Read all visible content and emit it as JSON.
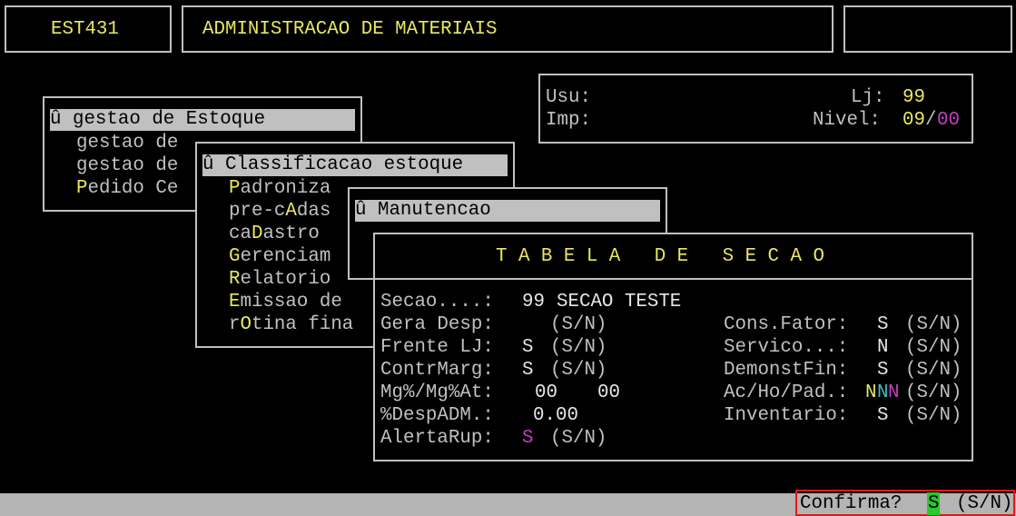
{
  "header": {
    "program_code": "EST431",
    "system_title": "ADMINISTRACAO DE MATERIAIS",
    "right_box": ""
  },
  "user_panel": {
    "usu_label": "Usu:",
    "imp_label": "Imp:",
    "lj_label": "Lj:",
    "lj_value": "99",
    "nivel_label": "Nivel:",
    "nivel_value_a": "09",
    "nivel_sep": "/",
    "nivel_value_b": "00"
  },
  "menu1": {
    "selected": "û gestao de Estoque",
    "items": [
      {
        "hot": "",
        "rest": "gestao de"
      },
      {
        "hot": "",
        "rest": "gestao de"
      },
      {
        "hot": "P",
        "rest": "edido Ce"
      }
    ]
  },
  "menu2": {
    "selected": "û Classificacao estoque",
    "items": [
      {
        "pre": "",
        "hot": "P",
        "post": "adroniza"
      },
      {
        "pre": "pre-c",
        "hot": "A",
        "post": "das"
      },
      {
        "pre": "ca",
        "hot": "D",
        "post": "astro"
      },
      {
        "pre": "",
        "hot": "G",
        "post": "erenciam"
      },
      {
        "pre": "",
        "hot": "R",
        "post": "elatorio"
      },
      {
        "pre": "",
        "hot": "E",
        "post": "missao de"
      },
      {
        "pre": "r",
        "hot": "O",
        "post": "tina fina"
      }
    ]
  },
  "menu3": {
    "selected": "û Manutencao"
  },
  "form": {
    "title": "T A B E L A   D E   S E C A O",
    "secao_label": "Secao....:",
    "secao_code": "99",
    "secao_name": "SECAO TESTE",
    "gera_desp_label": "Gera Desp:",
    "gera_desp_value": "",
    "gera_desp_hint": "(S/N)",
    "frente_lj_label": "Frente LJ:",
    "frente_lj_value": "S",
    "frente_lj_hint": "(S/N)",
    "contrmarg_label": "ContrMarg:",
    "contrmarg_value": "S",
    "contrmarg_hint": "(S/N)",
    "mg_label": "Mg%/Mg%At:",
    "mg_value_1": "00",
    "mg_value_2": "00",
    "despadm_label": "%DespADM.:",
    "despadm_value": "0.00",
    "alerta_label": "AlertaRup:",
    "alerta_value": "S",
    "alerta_hint": "(S/N)",
    "cons_fator_label": "Cons.Fator:",
    "cons_fator_value": "S",
    "cons_fator_hint": "(S/N)",
    "servico_label": "Servico...:",
    "servico_value": "N",
    "servico_hint": "(S/N)",
    "demonstfin_label": "DemonstFin:",
    "demonstfin_value": "S",
    "demonstfin_hint": "(S/N)",
    "acho_label": "Ac/Ho/Pad.:",
    "acho_v1": "N",
    "acho_v2": "N",
    "acho_v3": "N",
    "acho_hint": "(S/N)",
    "inventario_label": "Inventario:",
    "inventario_value": "S",
    "inventario_hint": "(S/N)"
  },
  "status_bar": {
    "confirm_label": "Confirma?",
    "confirm_value": "S",
    "confirm_hint": "(S/N)"
  }
}
